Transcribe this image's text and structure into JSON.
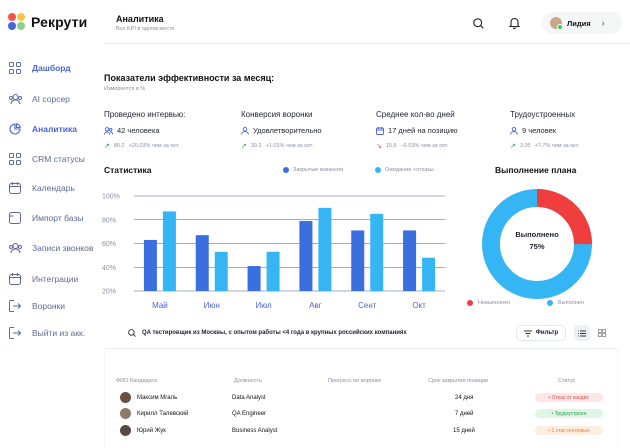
{
  "app": {
    "logo_text": "Рекрути",
    "logo_colors": [
      "#f35252",
      "#f7c744",
      "#4a63d8",
      "#8ad18f"
    ]
  },
  "sidebar": {
    "items": [
      {
        "label": "Дашборд",
        "icon": "grid-icon",
        "active": true
      },
      {
        "label": "AI сорсер",
        "icon": "users-icon",
        "active": false
      },
      {
        "label": "Аналитика",
        "icon": "pie-chart-icon",
        "active": true
      },
      {
        "label": "CRM статусы",
        "icon": "grid-icon",
        "active": false
      },
      {
        "label": "Календарь",
        "icon": "calendar-icon",
        "active": false
      },
      {
        "label": "Импорт базы",
        "icon": "folder-icon",
        "active": false
      },
      {
        "label": "Записи звонков",
        "icon": "users-icon",
        "active": false
      },
      {
        "label": "Интеграции",
        "icon": "calendar-icon",
        "active": false
      },
      {
        "label": "Воронки",
        "icon": "exit-icon",
        "active": false
      },
      {
        "label": "Выйти из акк.",
        "icon": "exit-icon",
        "active": false
      }
    ]
  },
  "header": {
    "title": "Аналитика",
    "subtitle": "Все KPI в одном месте",
    "user_name": "Лидия"
  },
  "kpi": {
    "title": "Показатели эффективности за месяц:",
    "subtitle": "Измеряется в %",
    "cards": [
      {
        "name": "Проведено интервью:",
        "value": "42 человека",
        "icon": "users-icon",
        "trend_value": "80.2",
        "trend_text": "+20.03% чем за окт.",
        "trend_dir": "up"
      },
      {
        "name": "Конверсия воронки",
        "value": "Удовлетворительно",
        "icon": "user-icon",
        "trend_value": "30.2",
        "trend_text": "+1.01% чем за окт.",
        "trend_dir": "up"
      },
      {
        "name": "Среднее кол-во дней",
        "value": "17 дней на позицию",
        "icon": "calendar-icon",
        "trend_value": "15.5",
        "trend_text": "−5.03% чем за окт.",
        "trend_dir": "down"
      },
      {
        "name": "Трудоустроенных",
        "value": "9 человек",
        "icon": "user-icon",
        "trend_value": "3.05",
        "trend_text": "+7.7% чем за окт.",
        "trend_dir": "up"
      }
    ]
  },
  "stats": {
    "title": "Статистика"
  },
  "chart_data": {
    "type": "bar",
    "categories": [
      "Май",
      "Июн",
      "Июл",
      "Авг",
      "Сент",
      "Окт"
    ],
    "series": [
      {
        "name": "Закрытые вакансии",
        "color": "#3a6fe0",
        "values": [
          63,
          67,
          41,
          79,
          71,
          71
        ]
      },
      {
        "name": "Ожидание +отказы",
        "color": "#36b5f5",
        "values": [
          87,
          53,
          53,
          90,
          85,
          48
        ]
      }
    ],
    "ylim": [
      20,
      100
    ],
    "yticks": [
      "20%",
      "40%",
      "60%",
      "80%",
      "100%"
    ],
    "ytick_values": [
      20,
      40,
      60,
      80,
      100
    ],
    "grid": true,
    "legend": "top-right"
  },
  "plan": {
    "title": "Выполнение плана",
    "center_label": "Выполнено",
    "center_value": "75%",
    "completed_fraction": 0.75,
    "legend_not_done": "Невыполнен",
    "legend_done": "Выполнен",
    "color_not_done": "#f03d3d",
    "color_done": "#36b5f5"
  },
  "search": {
    "query": "QA тестировщик из Москвы, с опытом работы <4 года в крупных российских компаниях",
    "filter_label": "Фильтр"
  },
  "table": {
    "headers": [
      "ФИО Кандидата",
      "Должность",
      "Прогресс по воронке",
      "Срок закрытия позиции",
      "Статус"
    ],
    "rows": [
      {
        "name": "Максим Мгаль",
        "position": "Data Analyst",
        "deadline": "24 дня",
        "status": "• Отказ от кандит.",
        "status_bg": "#fde6e6",
        "status_fg": "#e24b4b"
      },
      {
        "name": "Кирилл Талевский",
        "position": "QA Engineer",
        "deadline": "7 дней",
        "status": "• Трудоустроен",
        "status_bg": "#dff6e4",
        "status_fg": "#2aa150"
      },
      {
        "name": "Юрий Жук",
        "position": "Business Analyst",
        "deadline": "15 дней",
        "status": "• 1 этап интервью",
        "status_bg": "#fdeee0",
        "status_fg": "#e38a36"
      }
    ]
  }
}
